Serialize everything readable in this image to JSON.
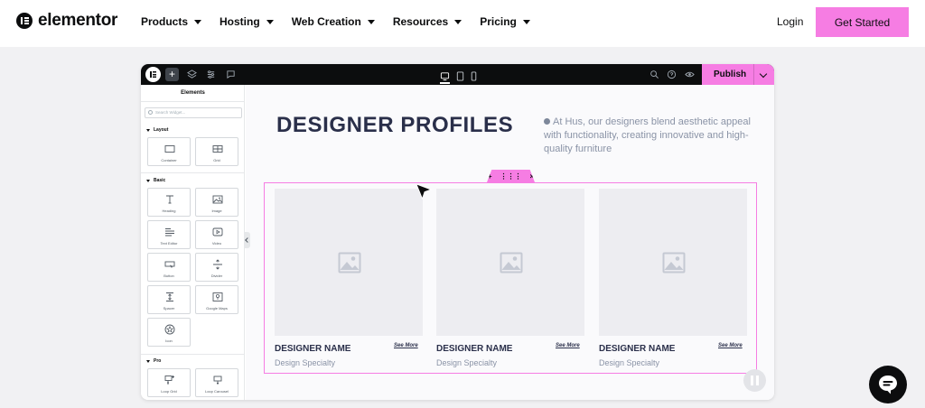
{
  "site": {
    "brand": "elementor",
    "nav": [
      {
        "label": "Products"
      },
      {
        "label": "Hosting"
      },
      {
        "label": "Web Creation"
      },
      {
        "label": "Resources"
      },
      {
        "label": "Pricing"
      }
    ],
    "login": "Login",
    "cta": "Get Started",
    "accent_color": "#f67de3"
  },
  "editor": {
    "toolbar": {
      "add": "+",
      "publish": "Publish"
    },
    "panel": {
      "title": "Elements",
      "search_placeholder": "Search Widget...",
      "sections": [
        {
          "title": "Layout",
          "widgets": [
            {
              "label": "Container",
              "icon": "container-icon"
            },
            {
              "label": "Grid",
              "icon": "grid-icon"
            }
          ]
        },
        {
          "title": "Basic",
          "widgets": [
            {
              "label": "Heading",
              "icon": "heading-icon"
            },
            {
              "label": "Image",
              "icon": "image-icon"
            },
            {
              "label": "Text Editor",
              "icon": "text-editor-icon"
            },
            {
              "label": "Video",
              "icon": "video-icon"
            },
            {
              "label": "Button",
              "icon": "button-icon"
            },
            {
              "label": "Divider",
              "icon": "divider-icon"
            },
            {
              "label": "Spacer",
              "icon": "spacer-icon"
            },
            {
              "label": "Google Maps",
              "icon": "map-icon"
            },
            {
              "label": "Icon",
              "icon": "star-icon"
            }
          ]
        },
        {
          "title": "Pro",
          "widgets": [
            {
              "label": "Loop Grid",
              "icon": "loop-grid-icon"
            },
            {
              "label": "Loop Carousel",
              "icon": "loop-carousel-icon"
            }
          ]
        }
      ]
    },
    "canvas": {
      "title": "DESIGNER PROFILES",
      "description": "At Hus, our designers blend aesthetic appeal with functionality, creating innovative and high-quality furniture",
      "handle": {
        "add": "+",
        "move": "⋮⋮⋮",
        "close": "×"
      },
      "cards": [
        {
          "name": "DESIGNER NAME",
          "more": "See More",
          "specialty": "Design Specialty"
        },
        {
          "name": "DESIGNER NAME",
          "more": "See More",
          "specialty": "Design Specialty"
        },
        {
          "name": "DESIGNER NAME",
          "more": "See More",
          "specialty": "Design Specialty"
        }
      ]
    }
  }
}
